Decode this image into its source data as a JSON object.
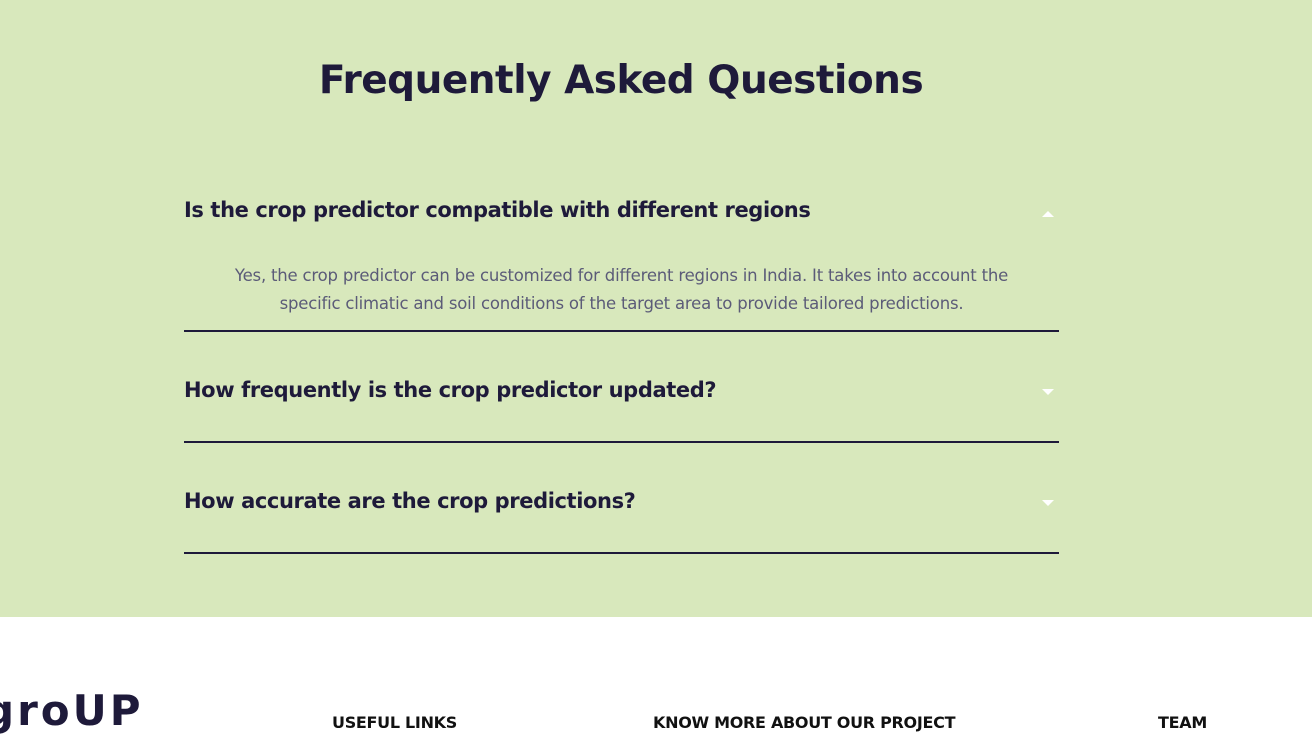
{
  "faq": {
    "title": "Frequently Asked Questions",
    "items": [
      {
        "question": "Is the crop predictor compatible with different regions",
        "answer_line1": "Yes, the crop predictor can be customized for different regions in India. It takes into account the",
        "answer_line2": "specific climatic and soil conditions of the target area to provide tailored predictions.",
        "expanded": true,
        "toggle_icon": "caret-up-icon"
      },
      {
        "question": "How frequently is the crop predictor updated?",
        "expanded": false,
        "toggle_icon": "caret-down-icon"
      },
      {
        "question": "How accurate are the crop predictions?",
        "expanded": false,
        "toggle_icon": "caret-down-icon"
      }
    ]
  },
  "footer": {
    "logo_text": "groUP",
    "useful_links_heading": "USEFUL LINKS",
    "project_heading": "KNOW MORE ABOUT OUR PROJECT",
    "team_heading": "TEAM"
  },
  "colors": {
    "faq_background": "#d8e8bc",
    "heading_text": "#1e1a3a",
    "answer_text": "#5b5b78",
    "footer_background": "#ffffff",
    "toggle_icon": "#ffffff"
  }
}
